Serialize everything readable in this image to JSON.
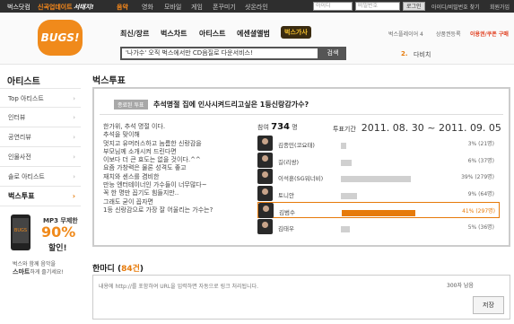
{
  "topbar": {
    "brand": "벅스닷컴",
    "update_notice": "신곡업데이트",
    "tagline": "서태지!",
    "menu": [
      "음악",
      "영화",
      "모바일",
      "게임",
      "폰꾸미기",
      "샷온라인"
    ],
    "id_placeholder": "아이디",
    "pw_placeholder": "비밀번호",
    "login_label": "로그인",
    "find_label": "아이디/비밀번호 찾기",
    "join_label": "회원가입"
  },
  "header": {
    "logo": "BUGS!",
    "gnb": [
      "최신/장르",
      "벅스차트",
      "아티스트",
      "에센셜앨범",
      "벅스가사"
    ],
    "search_value": "'나가수' 오직 벅스에서만 CD음질로 다운서비스!",
    "search_button": "검색",
    "player_label": "벅스플레이어 4",
    "product_label": "상품권등록",
    "coupon_label": "이용권/쿠폰 구매",
    "rank_number": "2.",
    "rank_text": "다비치"
  },
  "sidebar": {
    "title": "아티스트",
    "items": [
      {
        "label": "Top 아티스트"
      },
      {
        "label": "인터뷰"
      },
      {
        "label": "공연리뷰"
      },
      {
        "label": "인물사전"
      },
      {
        "label": "솔로 아티스트"
      },
      {
        "label": "벅스투표"
      }
    ],
    "promo": {
      "brand": "BUGS",
      "title": "MP3 무제한",
      "discount": "90%",
      "discount_suffix": "할인!",
      "footer_line1": "벅스와 함께 음악을",
      "footer_highlight": "스마트",
      "footer_line2": "하게 즐기세요!"
    }
  },
  "main": {
    "title": "벅스투표",
    "vote": {
      "status_tag": "종료된 투표",
      "question": "추석명절 집에 인사시켜드리고싶은 1등신랑감가수?",
      "description": [
        "한가위, 추석 명절 이다.",
        "추석을 맞이해",
        "멋지고 유머러스하고 늠름한 신랑감을",
        "부모님께 소개시켜 드린다면",
        "이보다 더 큰 효도는 없을 것이다.^^",
        "요즘 가창력은 물론 성격도 좋고",
        "재치와 센스를 겸비한",
        "만능 엔터테이너인 가수들이 너무많다~",
        "꼭 한 명만 꼽기도 힘들지만..",
        "그래도 굳이 꼽자면",
        "1등 신랑감으로 가장 잘 어울리는 가수는?"
      ],
      "participants_label": "참여",
      "participants_count": "734",
      "participants_unit": "명",
      "period_label": "투표기간",
      "period": "2011. 08. 30 ~ 2011. 09. 05",
      "candidates": [
        {
          "name": "김종민(코요태)",
          "percent": 3,
          "result": "3% (21명)"
        },
        {
          "name": "길(리쌍)",
          "percent": 6,
          "result": "6% (37명)"
        },
        {
          "name": "이석훈(SG워너비)",
          "percent": 39,
          "result": "39% (279명)"
        },
        {
          "name": "토니안",
          "percent": 9,
          "result": "9% (64명)"
        },
        {
          "name": "김범수",
          "percent": 41,
          "result": "41% (297명)",
          "winner": true
        },
        {
          "name": "김태우",
          "percent": 5,
          "result": "5% (36명)"
        }
      ]
    },
    "comments": {
      "title": "한마디",
      "count": "84건",
      "guide": "내용에 http://를 포함하여 URL을 입력하면 자동으로 링크 처리됩니다.",
      "remaining": "300자 남음",
      "save_label": "저장"
    }
  },
  "colors": {
    "accent": "#e67a0a",
    "topbar_bg": "#2e2e2e",
    "logo_bg": "#f08a1b"
  }
}
